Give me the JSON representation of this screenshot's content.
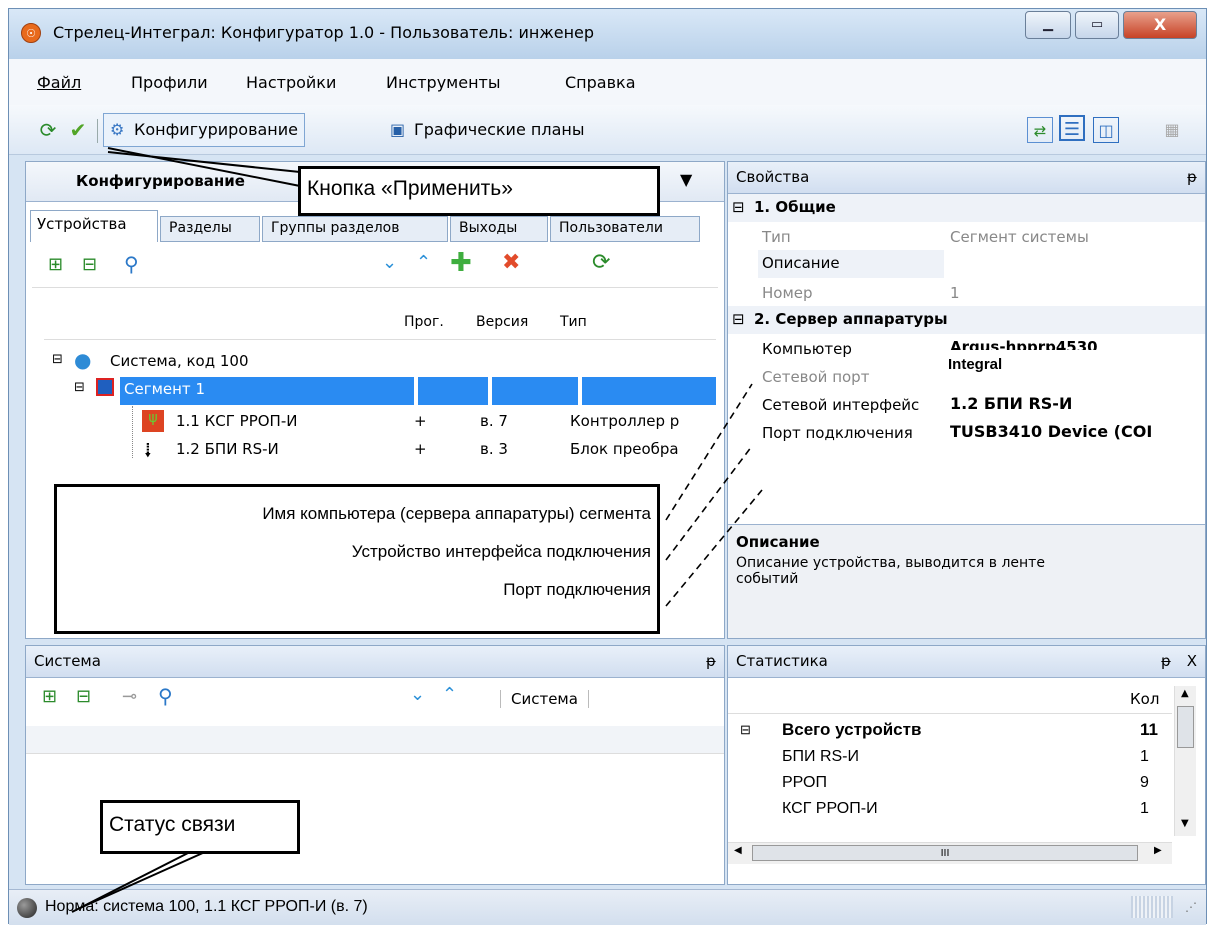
{
  "window": {
    "title": "Стрелец-Интеграл: Конфигуратор 1.0 - Пользователь: инженер",
    "min": "▁",
    "max": "▭",
    "close": "X"
  },
  "menu": [
    "Файл",
    "Профили",
    "Настройки",
    "Инструменты",
    "Справка"
  ],
  "toolbar": {
    "config": "Конфигурирование",
    "plans": "Графические планы"
  },
  "config_panel": {
    "title": "Конфигурирование",
    "tabs": [
      "Устройства",
      "Разделы",
      "Группы разделов",
      "Выходы",
      "Пользователи"
    ],
    "cols": {
      "prog": "Прог.",
      "ver": "Версия",
      "type": "Тип"
    },
    "tree": {
      "system": "Система, код 100",
      "segment": "Сегмент 1",
      "dev1": {
        "name": "1.1 КСГ РРОП-И",
        "prog": "+",
        "ver": "в. 7",
        "type": "Контроллер р"
      },
      "dev2": {
        "name": "1.2 БПИ RS-И",
        "prog": "+",
        "ver": "в. 3",
        "type": "Блок преобра"
      }
    }
  },
  "properties": {
    "title": "Свойства",
    "pin": "ᵽ",
    "group1": "1. Общие",
    "type_k": "Тип",
    "type_v": "Сегмент системы",
    "desc_k": "Описание",
    "num_k": "Номер",
    "num_v": "1",
    "group2": "2. Сервер аппаратуры",
    "comp_k": "Компьютер",
    "comp_v": "Argus-hpprp4530",
    "port_k": "Сетевой порт",
    "port_v": "Integral",
    "iface_k": "Сетевой интерфейс",
    "iface_v": "1.2 БПИ RS-И",
    "conn_k": "Порт подключения",
    "conn_v": "TUSB3410 Device (COI",
    "desc_title": "Описание",
    "desc_text": "Описание устройства, выводится в ленте событий"
  },
  "system_panel": {
    "title": "Система",
    "col": "Система",
    "pin": "ᵽ"
  },
  "stats_panel": {
    "title": "Статистика",
    "col": "Кол",
    "rows": [
      {
        "name": "Всего устройств",
        "val": "11"
      },
      {
        "name": "БПИ RS-И",
        "val": "1"
      },
      {
        "name": "РРОП",
        "val": "9"
      },
      {
        "name": "КСГ РРОП-И",
        "val": "1"
      }
    ],
    "scroll_mid": "III",
    "pin": "ᵽ",
    "close": "X"
  },
  "status": {
    "text": "Норма:  система 100, 1.1 КСГ РРОП-И (в. 7)"
  },
  "callouts": {
    "apply": "Кнопка «Применить»",
    "comp": "Имя компьютера (сервера аппаратуры) сегмента",
    "iface": "Устройство интерфейса подключения",
    "port": "Порт подключения",
    "status": "Статус связи"
  }
}
